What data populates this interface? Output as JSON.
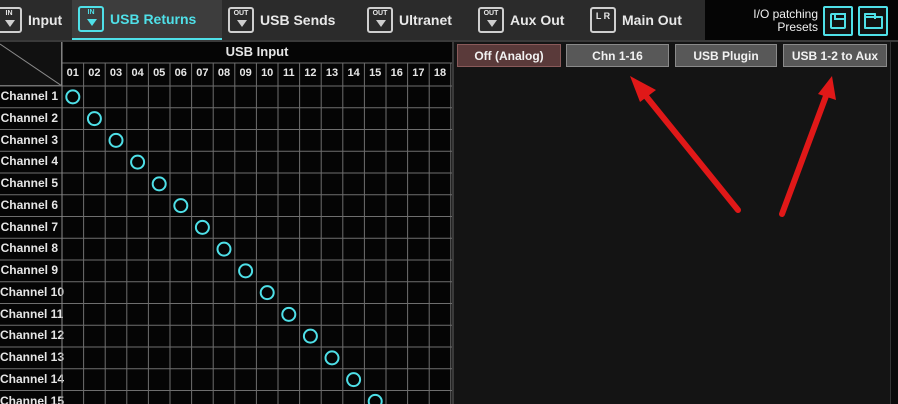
{
  "tabs": [
    {
      "label": "Input",
      "icon": "input-tab-icon",
      "icon_text": "IN",
      "active": false
    },
    {
      "label": "USB Returns",
      "icon": "usb-returns-icon",
      "icon_text": "IN",
      "active": true
    },
    {
      "label": "USB Sends",
      "icon": "usb-sends-icon",
      "icon_text": "OUT",
      "active": false
    },
    {
      "label": "Ultranet",
      "icon": "ultranet-icon",
      "icon_text": "OUT",
      "active": false
    },
    {
      "label": "Aux Out",
      "icon": "aux-out-icon",
      "icon_text": "OUT",
      "active": false
    },
    {
      "label": "Main Out",
      "icon": "main-out-icon",
      "icon_text": "L R",
      "active": false
    }
  ],
  "presets": {
    "label_line1": "I/O patching",
    "label_line2": "Presets",
    "save_icon": "save-icon",
    "open_icon": "folder-icon"
  },
  "matrix": {
    "title": "USB Input",
    "columns": [
      "01",
      "02",
      "03",
      "04",
      "05",
      "06",
      "07",
      "08",
      "09",
      "10",
      "11",
      "12",
      "13",
      "14",
      "15",
      "16",
      "17",
      "18"
    ],
    "rows": [
      "Channel 1",
      "Channel 2",
      "Channel 3",
      "Channel 4",
      "Channel 5",
      "Channel 6",
      "Channel 7",
      "Channel 8",
      "Channel 9",
      "Channel 10",
      "Channel 11",
      "Channel 12",
      "Channel 13",
      "Channel 14",
      "Channel 15"
    ],
    "patched_column_for_row": [
      1,
      2,
      3,
      4,
      5,
      6,
      7,
      8,
      9,
      10,
      11,
      12,
      13,
      14,
      15
    ]
  },
  "options": [
    {
      "label": "Off (Analog)",
      "state": "off"
    },
    {
      "label": "Chn 1-16",
      "state": "normal"
    },
    {
      "label": "USB Plugin",
      "state": "normal"
    },
    {
      "label": "USB 1-2 to Aux",
      "state": "normal"
    }
  ],
  "colors": {
    "accent": "#4fe0e8",
    "arrow": "#e01818",
    "grid_line": "#6e6e6e"
  }
}
